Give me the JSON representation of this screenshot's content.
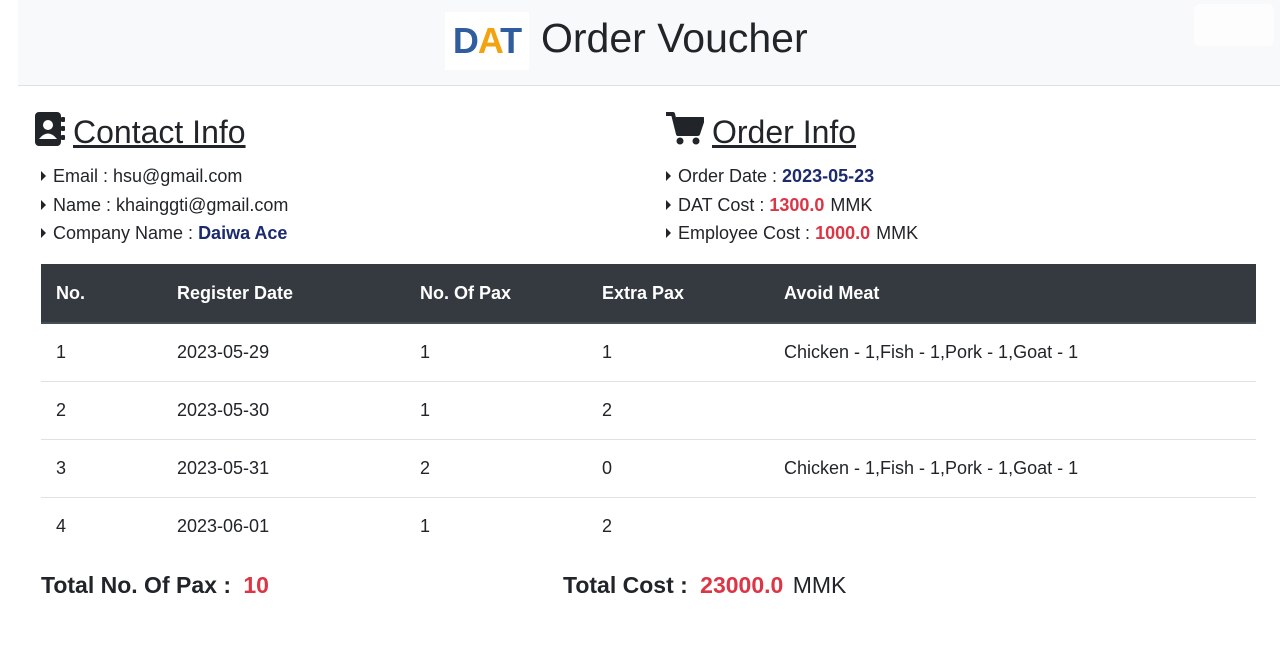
{
  "header": {
    "logo_text": "DAT",
    "title": "Order Voucher"
  },
  "contact": {
    "title": "Contact Info",
    "items": [
      {
        "label": "Email : ",
        "value": "hsu@gmail.com"
      },
      {
        "label": "Name : ",
        "value": "khainggti@gmail.com"
      },
      {
        "label": "Company Name : ",
        "value": "Daiwa Ace"
      }
    ]
  },
  "order": {
    "title": "Order Info",
    "order_date_label": "Order Date : ",
    "order_date": "2023-05-23",
    "dat_cost_label": "DAT Cost : ",
    "dat_cost": "1300.0",
    "employee_cost_label": "Employee Cost : ",
    "employee_cost": "1000.0",
    "currency": "MMK"
  },
  "table": {
    "headers": [
      "No.",
      "Register Date",
      "No. Of Pax",
      "Extra Pax",
      "Avoid Meat"
    ],
    "rows": [
      [
        "1",
        "2023-05-29",
        "1",
        "1",
        "Chicken - 1,Fish - 1,Pork - 1,Goat - 1"
      ],
      [
        "2",
        "2023-05-30",
        "1",
        "2",
        ""
      ],
      [
        "3",
        "2023-05-31",
        "2",
        "0",
        "Chicken - 1,Fish - 1,Pork - 1,Goat - 1"
      ],
      [
        "4",
        "2023-06-01",
        "1",
        "2",
        ""
      ]
    ]
  },
  "totals": {
    "pax_label": "Total No. Of Pax : ",
    "pax_value": "10",
    "cost_label": "Total Cost : ",
    "cost_value": "23000.0",
    "currency": "MMK"
  },
  "colors": {
    "accent_red": "#dc3545",
    "accent_navy": "#1c2a6e",
    "table_header": "#343a40"
  }
}
